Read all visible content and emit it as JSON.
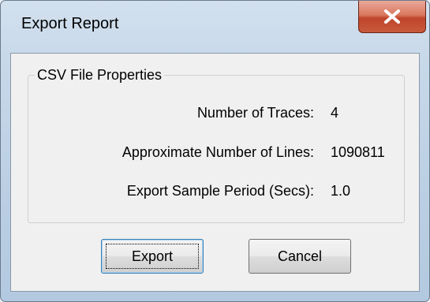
{
  "window": {
    "title": "Export Report",
    "close_icon": "close-x-icon"
  },
  "group": {
    "legend": "CSV File Properties",
    "rows": [
      {
        "label": "Number of Traces:",
        "value": "4"
      },
      {
        "label": "Approximate Number of Lines:",
        "value": "1090811"
      },
      {
        "label": "Export Sample Period (Secs):",
        "value": "1.0"
      }
    ]
  },
  "buttons": {
    "export_label": "Export",
    "cancel_label": "Cancel"
  },
  "colors": {
    "close_button": "#c85a3c",
    "client_bg": "#f0f0f0",
    "default_button_border": "#3c7fb1"
  }
}
